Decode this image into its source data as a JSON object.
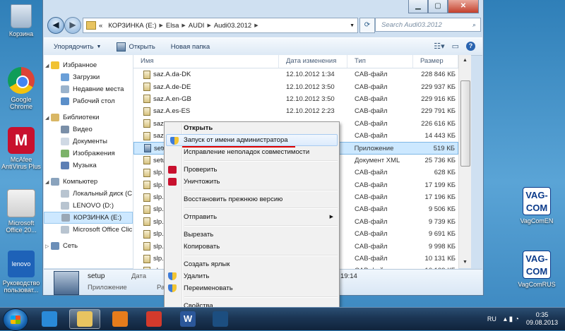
{
  "desktop": {
    "icons_left": [
      {
        "label": "Корзина",
        "icon": "recycle-bin-icon"
      },
      {
        "label": "Google Chrome",
        "icon": "chrome-icon"
      },
      {
        "label": "McAfee AntiVirus Plus",
        "icon": "mcafee-icon"
      },
      {
        "label": "Microsoft Office 20...",
        "icon": "office-icon"
      },
      {
        "label": "Руководство пользоват...",
        "icon": "lenovo-icon"
      }
    ],
    "icons_right": [
      {
        "label": "VagComEN",
        "icon_text": "VAG-COM",
        "icon": "vagcom-icon"
      },
      {
        "label": "VagComRUS",
        "icon_text": "VAG-COM",
        "icon": "vagcom-icon"
      }
    ]
  },
  "explorer": {
    "caption_buttons": {
      "minimize": "▁",
      "maximize": "▢",
      "close": "✕"
    },
    "address": {
      "prefix": "«",
      "segments": [
        "КОРЗИНКА (E:)",
        "Elsa",
        "AUDI",
        "Audi03.2012"
      ]
    },
    "search": {
      "placeholder": "Search Audi03.2012"
    },
    "toolbar": {
      "organize": "Упорядочить",
      "open": "Открыть",
      "new_folder": "Новая папка"
    },
    "nav_pane": [
      {
        "label": "Избранное",
        "group": true
      },
      {
        "label": "Загрузки"
      },
      {
        "label": "Недавние места"
      },
      {
        "label": "Рабочий стол"
      },
      {
        "label": "Библиотеки",
        "group": true
      },
      {
        "label": "Видео"
      },
      {
        "label": "Документы"
      },
      {
        "label": "Изображения"
      },
      {
        "label": "Музыка"
      },
      {
        "label": "Компьютер",
        "group": true
      },
      {
        "label": "Локальный диск (C"
      },
      {
        "label": "LENOVO (D:)"
      },
      {
        "label": "КОРЗИНКА (E:)",
        "selected": true
      },
      {
        "label": "Microsoft Office Clic"
      },
      {
        "label": "Сеть",
        "group": true
      }
    ],
    "columns": {
      "name": "Имя",
      "date": "Дата изменения",
      "type": "Тип",
      "size": "Размер"
    },
    "files": [
      {
        "name": "saz.A.da-DK",
        "date": "12.10.2012 1:34",
        "type": "CAB-файл",
        "size": "228 846 КБ"
      },
      {
        "name": "saz.A.de-DE",
        "date": "12.10.2012 3:50",
        "type": "CAB-файл",
        "size": "229 937 КБ"
      },
      {
        "name": "saz.A.en-GB",
        "date": "12.10.2012 3:50",
        "type": "CAB-файл",
        "size": "229 916 КБ"
      },
      {
        "name": "saz.A.es-ES",
        "date": "12.10.2012 2:23",
        "type": "CAB-файл",
        "size": "229 791 КБ"
      },
      {
        "name": "saz",
        "date": "",
        "type": "CAB-файл",
        "size": "226 616 КБ"
      },
      {
        "name": "saz",
        "date": "",
        "type": "CAB-файл",
        "size": "14 443 КБ"
      },
      {
        "name": "setu",
        "date": "",
        "type": "Приложение",
        "size": "519 КБ",
        "selected": true,
        "exe": true
      },
      {
        "name": "setu",
        "date": "",
        "type": "Документ XML",
        "size": "25 736 КБ"
      },
      {
        "name": "slp.",
        "date": "",
        "type": "CAB-файл",
        "size": "628 КБ"
      },
      {
        "name": "slp.",
        "date": "",
        "type": "CAB-файл",
        "size": "17 199 КБ"
      },
      {
        "name": "slp.",
        "date": "",
        "type": "CAB-файл",
        "size": "17 196 КБ"
      },
      {
        "name": "slp.",
        "date": "",
        "type": "CAB-файл",
        "size": "9 506 КБ"
      },
      {
        "name": "slp.",
        "date": "",
        "type": "CAB-файл",
        "size": "9 739 КБ"
      },
      {
        "name": "slp.",
        "date": "",
        "type": "CAB-файл",
        "size": "9 691 КБ"
      },
      {
        "name": "slp.",
        "date": "",
        "type": "CAB-файл",
        "size": "9 998 КБ"
      },
      {
        "name": "slp.",
        "date": "",
        "type": "CAB-файл",
        "size": "10 131 КБ"
      },
      {
        "name": "slp.",
        "date": "",
        "type": "CAB-файл",
        "size": "10 199 КБ"
      }
    ],
    "details": {
      "name": "setup",
      "type": "Приложение",
      "date_label": "Дата",
      "size_label": "Ра",
      "time_fragment": "19:14"
    }
  },
  "context_menu": [
    {
      "label": "Открыть",
      "bold": true
    },
    {
      "label": "Запуск от имени администратора",
      "icon": "shield",
      "highlighted": true
    },
    {
      "label": "Исправление неполадок совместимости"
    },
    {
      "sep": true
    },
    {
      "label": "Проверить",
      "icon": "mcafee"
    },
    {
      "label": "Уничтожить",
      "icon": "mcafee"
    },
    {
      "sep": true
    },
    {
      "label": "Восстановить прежнюю версию"
    },
    {
      "sep": true
    },
    {
      "label": "Отправить",
      "submenu": true
    },
    {
      "sep": true
    },
    {
      "label": "Вырезать"
    },
    {
      "label": "Копировать"
    },
    {
      "sep": true
    },
    {
      "label": "Создать ярлык"
    },
    {
      "label": "Удалить",
      "icon": "shield"
    },
    {
      "label": "Переименовать",
      "icon": "shield"
    },
    {
      "sep": true
    },
    {
      "label": "Свойства"
    }
  ],
  "taskbar": {
    "apps": [
      {
        "name": "ie",
        "color": "#2a8ad8"
      },
      {
        "name": "explorer",
        "color": "#e8c460",
        "active": true
      },
      {
        "name": "media-player",
        "color": "#e57c1c"
      },
      {
        "name": "chrome",
        "color": "#d33a2c"
      },
      {
        "name": "word",
        "color": "#2b579a",
        "label": "W"
      },
      {
        "name": "video-app",
        "color": "#1c4e80"
      }
    ],
    "language": "RU",
    "time": "0:35",
    "date": "09.08.2013"
  }
}
